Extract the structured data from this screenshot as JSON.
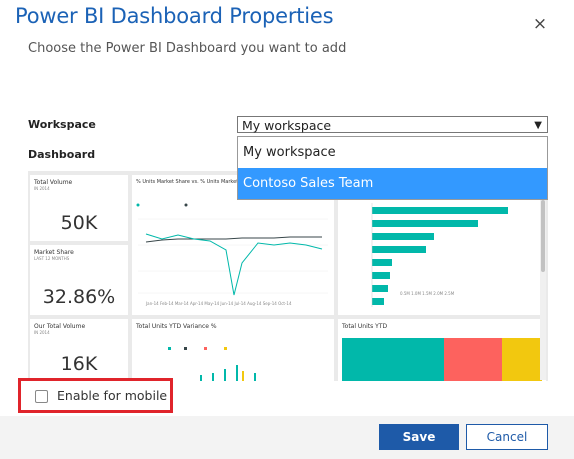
{
  "dialog": {
    "title": "Power BI Dashboard Properties",
    "subtitle": "Choose the Power BI Dashboard you want to add",
    "close_glyph": "×"
  },
  "form": {
    "workspace_label": "Workspace",
    "workspace_value": "My workspace",
    "dashboard_label": "Dashboard",
    "dropdown_options": [
      "My workspace",
      "Contoso Sales Team"
    ],
    "dropdown_selected": "Contoso Sales Team"
  },
  "preview": {
    "tiles": [
      {
        "title": "Total Volume",
        "sub": "IN 2014",
        "value": "50K"
      },
      {
        "title": "Market Share",
        "sub": "LAST 12 MONTHS",
        "value": "32.86%"
      },
      {
        "title": "Our Total Volume",
        "sub": "IN 2014",
        "value": "16K"
      }
    ],
    "line_tile_title": "% Units Market Share vs. % Units Market Share...",
    "variance_tile_title": "Total Units YTD Variance %",
    "treemap_tile_title": "Total Units YTD"
  },
  "mobile": {
    "label": "Enable for mobile",
    "checked": false
  },
  "buttons": {
    "save": "Save",
    "cancel": "Cancel"
  },
  "colors": {
    "accent": "#1e5aa8",
    "title": "#1b62b6",
    "highlight": "#3399ff",
    "teal": "#01b8aa",
    "callout": "#e0242b"
  }
}
